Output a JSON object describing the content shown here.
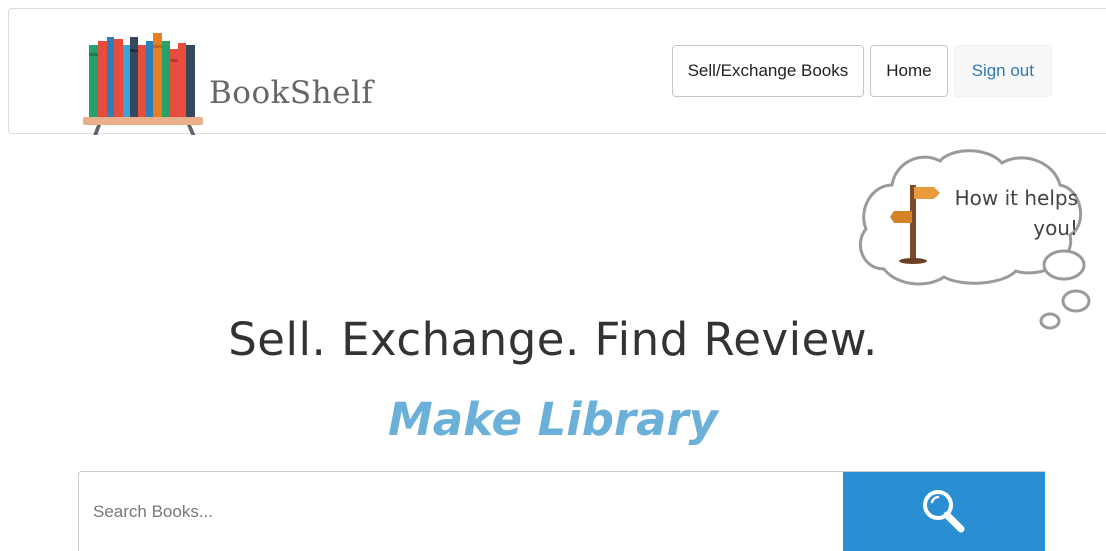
{
  "brand": {
    "name": "BookShelf",
    "logo_icon": "bookshelf-icon"
  },
  "nav": {
    "sell_exchange": "Sell/Exchange Books",
    "home": "Home",
    "sign_out": "Sign out"
  },
  "help_bubble": {
    "line1": "How it helps",
    "line2": "you!",
    "icon": "signpost-icon"
  },
  "hero": {
    "title": "Sell. Exchange. Find Review.",
    "subtitle": "Make Library"
  },
  "search": {
    "placeholder": "Search Books...",
    "value": "",
    "button_icon": "search-icon"
  },
  "colors": {
    "accent_blue": "#2a8fd2",
    "subtitle_blue": "#6ab0d9",
    "link_blue": "#2d79b5",
    "shelf": "#e9b08a"
  }
}
